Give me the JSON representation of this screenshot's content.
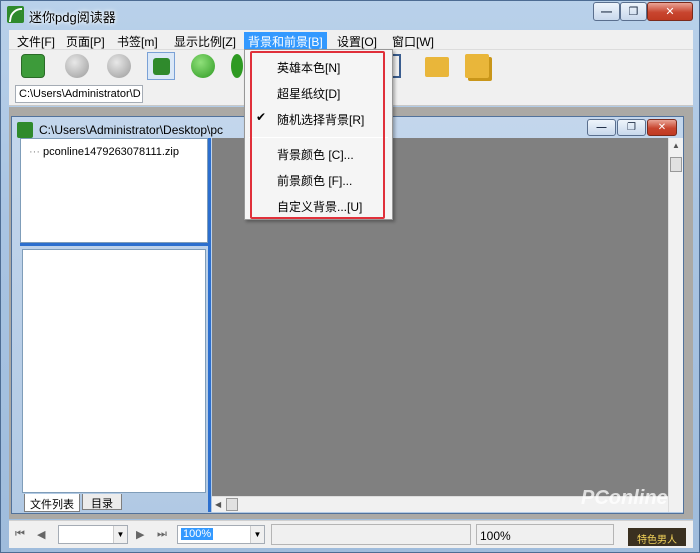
{
  "window": {
    "title": "迷你pdg阅读器",
    "min": "—",
    "max": "❐",
    "close": "✕"
  },
  "menubar": {
    "items": [
      "文件[F]",
      "页面[P]",
      "书签[m]",
      "显示比例[Z]",
      "背景和前景[B]",
      "设置[O]",
      "窗口[W]"
    ]
  },
  "toolbar": {
    "path": "C:\\Users\\Administrator\\D"
  },
  "child": {
    "title": "C:\\Users\\Administrator\\Desktop\\pc"
  },
  "tree": {
    "item": "pconline1479263078111.zip",
    "connector": "···"
  },
  "tabs": {
    "files": "文件列表",
    "toc": "目录"
  },
  "dropdown": {
    "items": [
      "英雄本色[N]",
      "超星纸纹[D]",
      "随机选择背景[R]",
      "背景颜色 [C]...",
      "前景颜色 [F]...",
      "自定义背景...[U]"
    ],
    "checked_index": 2,
    "check": "✔"
  },
  "statusbar": {
    "zoom_combo": "100%",
    "zoom_status": "100%"
  },
  "watermark": "PConline",
  "stamp": "特色男人",
  "colors": {
    "highlight": "#3399ff",
    "annotation": "#e0303a",
    "view_bg": "#808080",
    "splitter": "#2c6fce"
  }
}
